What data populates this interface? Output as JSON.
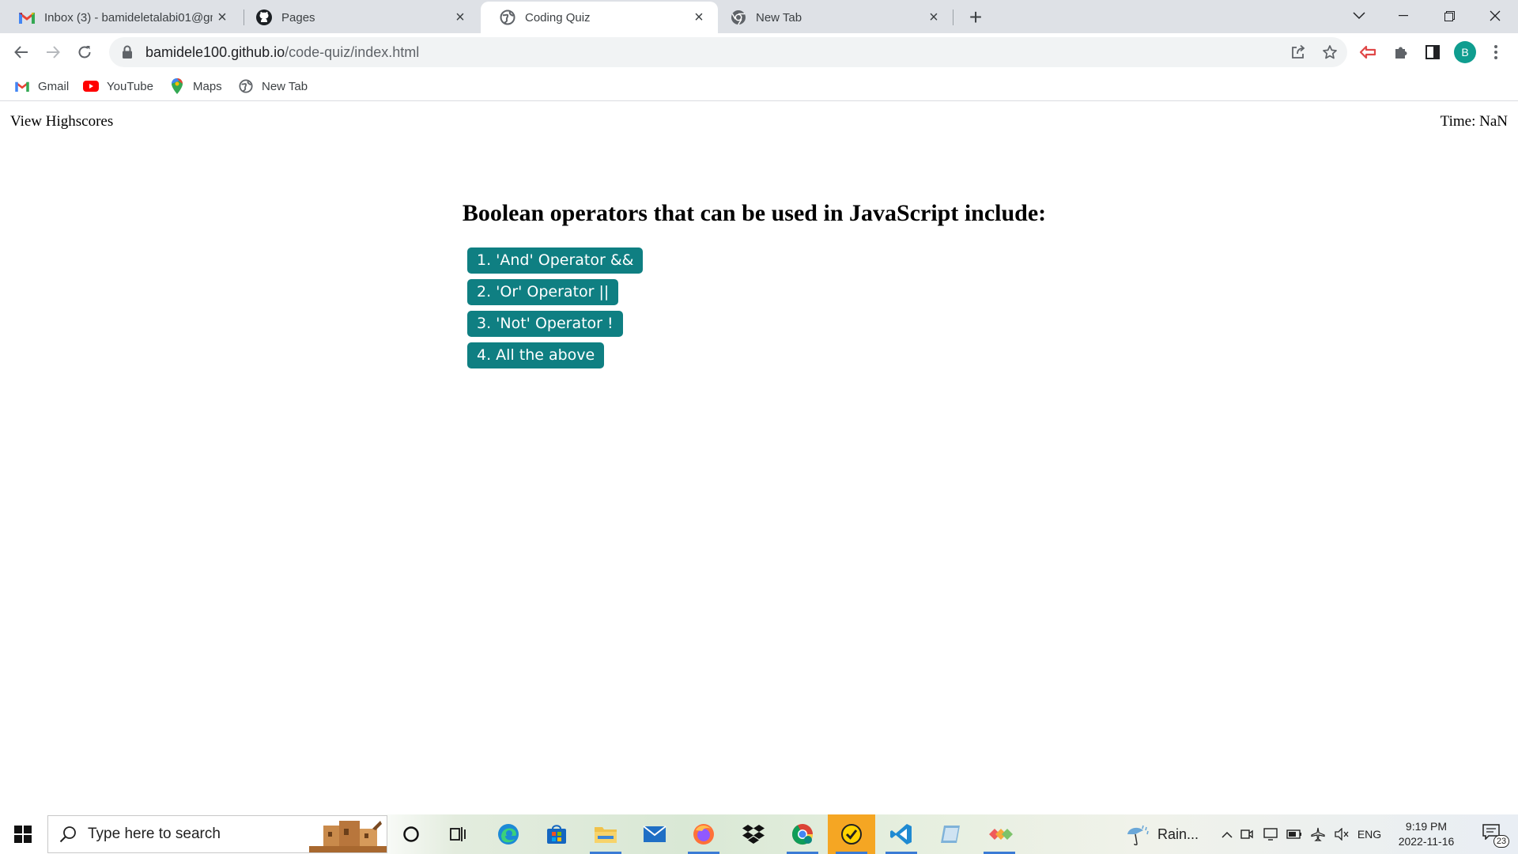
{
  "browser": {
    "tabs": [
      {
        "title": "Inbox (3) - bamideletalabi01@gm",
        "icon": "gmail-icon"
      },
      {
        "title": "Pages",
        "icon": "github-icon"
      },
      {
        "title": "Coding Quiz",
        "icon": "globe-icon",
        "active": true
      },
      {
        "title": "New Tab",
        "icon": "chrome-icon"
      }
    ],
    "url_host": "bamidele100.github.io",
    "url_path": "/code-quiz/index.html",
    "profile_initial": "B",
    "bookmarks": [
      {
        "label": "Gmail",
        "icon": "gmail-icon"
      },
      {
        "label": "YouTube",
        "icon": "youtube-icon"
      },
      {
        "label": "Maps",
        "icon": "maps-icon"
      },
      {
        "label": "New Tab",
        "icon": "globe-icon"
      }
    ]
  },
  "quiz": {
    "highscores_link": "View Highscores",
    "timer": "Time: NaN",
    "question": "Boolean operators that can be used in JavaScript include:",
    "choices": [
      "1. 'And' Operator &&",
      "2. 'Or' Operator ||",
      "3. 'Not' Operator !",
      "4. All the above"
    ],
    "button_color": "#0f7f82"
  },
  "taskbar": {
    "search_placeholder": "Type here to search",
    "weather": "Rain...",
    "language": "ENG",
    "time": "9:19 PM",
    "date": "2022-11-16",
    "notifications": "23"
  }
}
